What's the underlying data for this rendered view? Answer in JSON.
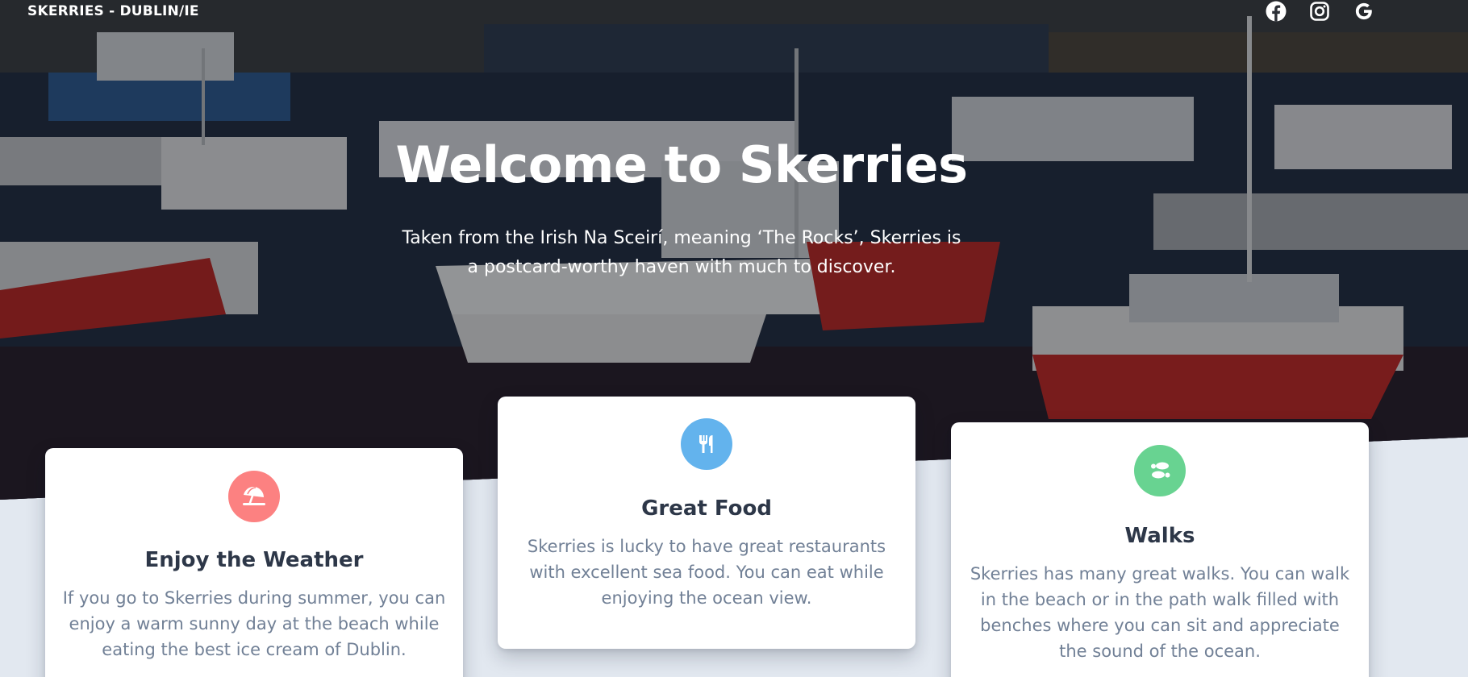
{
  "nav": {
    "brand": "SKERRIES - DUBLIN/IE",
    "social": [
      {
        "name": "facebook-icon"
      },
      {
        "name": "instagram-icon"
      },
      {
        "name": "google-icon"
      }
    ]
  },
  "hero": {
    "title": "Welcome to Skerries",
    "subtitle": "Taken from the Irish Na Sceirí, meaning ‘The Rocks’, Skerries is a postcard-worthy haven with much to discover."
  },
  "cards": [
    {
      "icon": "beach-umbrella-icon",
      "color": "#fc8181",
      "title": "Enjoy the Weather",
      "text": "If you go to Skerries during summer, you can enjoy a warm sunny day at the beach while eating the best ice cream of Dublin."
    },
    {
      "icon": "utensils-icon",
      "color": "#63b3ed",
      "title": "Great Food",
      "text": "Skerries is lucky to have great restaurants with excellent sea food. You can eat while enjoying the ocean view."
    },
    {
      "icon": "footprints-icon",
      "color": "#68d391",
      "title": "Walks",
      "text": "Skerries has many great walks. You can walk in the beach or in the path walk filled with benches where you can sit and appreciate the sound of the ocean."
    }
  ],
  "colors": {
    "page_background": "#e2e8f0",
    "card_title": "#2d3748",
    "card_text": "#718096"
  }
}
